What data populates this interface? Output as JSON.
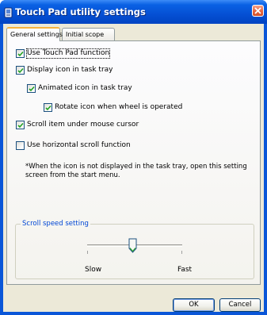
{
  "window": {
    "title": "Touch Pad utility settings",
    "title_color": "#ffffff",
    "titlebar_color": "#0a56d8",
    "close_color": "#e5653f"
  },
  "tabs": [
    {
      "label": "General settings",
      "active": true
    },
    {
      "label": "Initial scope",
      "active": false
    }
  ],
  "options": {
    "use_touchpad": {
      "label": "Use Touch Pad function",
      "checked": true
    },
    "display_icon": {
      "label": "Display icon in task tray",
      "checked": true
    },
    "animated_icon": {
      "label": "Animated icon in task tray",
      "checked": true
    },
    "rotate_icon": {
      "label": "Rotate icon when wheel is operated",
      "checked": true
    },
    "scroll_under_cursor": {
      "label": "Scroll item under mouse cursor",
      "checked": true
    },
    "horizontal_scroll": {
      "label": "Use horizontal scroll function",
      "checked": false
    }
  },
  "note": "*When the icon is not displayed in the task tray, open this setting screen from the start menu.",
  "scroll_speed": {
    "group_label": "Scroll speed setting",
    "label_color": "#0046d5",
    "min_label": "Slow",
    "max_label": "Fast",
    "value_fraction": 0.5
  },
  "buttons": {
    "ok": "OK",
    "cancel": "Cancel"
  },
  "icons": {
    "app": "touchpad-utility-icon",
    "close": "close-icon",
    "check": "checkmark-icon"
  }
}
